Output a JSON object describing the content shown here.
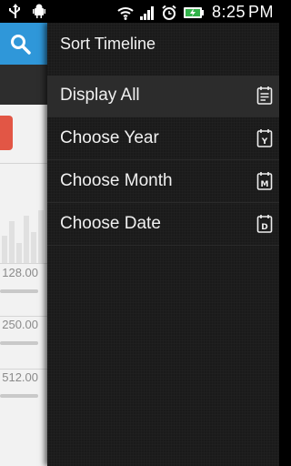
{
  "status_bar": {
    "time": "8:25",
    "time_suffix": "PM",
    "left_icons": [
      "usb-icon",
      "android-debug-icon"
    ],
    "right_icons": [
      "wifi-icon",
      "signal-icon",
      "alarm-icon",
      "battery-charging-icon"
    ]
  },
  "background_app": {
    "amounts": [
      "128.00",
      "250.00",
      "512.00"
    ]
  },
  "drawer": {
    "title": "Sort Timeline",
    "items": [
      {
        "label": "Display All",
        "icon": "calendar-list-icon",
        "icon_letter": "",
        "selected": true
      },
      {
        "label": "Choose Year",
        "icon": "calendar-year-icon",
        "icon_letter": "Y",
        "selected": false
      },
      {
        "label": "Choose Month",
        "icon": "calendar-month-icon",
        "icon_letter": "M",
        "selected": false
      },
      {
        "label": "Choose Date",
        "icon": "calendar-date-icon",
        "icon_letter": "D",
        "selected": false
      }
    ]
  },
  "colors": {
    "app_blue": "#2f97d9",
    "red_button": "#e25645",
    "drawer_bg": "#1a1a1a",
    "selected_bg": "#2c2c2c"
  }
}
